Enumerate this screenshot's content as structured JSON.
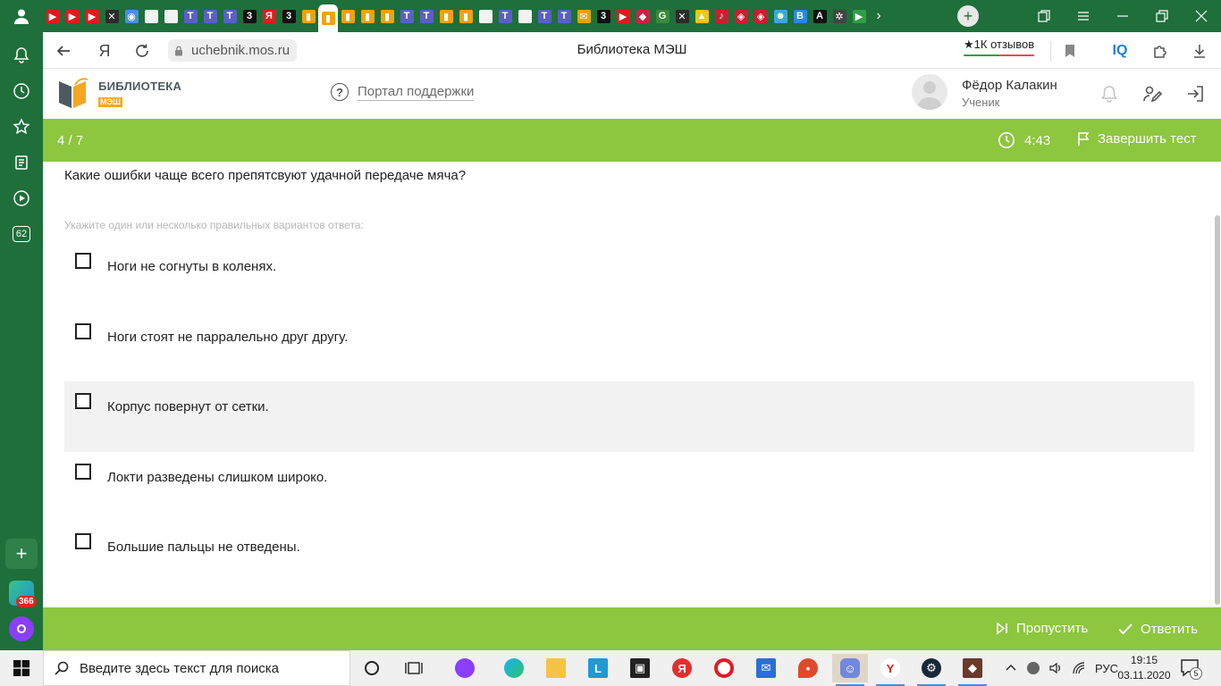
{
  "browser": {
    "url": "uchebnik.mos.ru",
    "page_title": "Библиотека МЭШ",
    "reviews_label": "★1К отзывов",
    "iq_label": "IQ",
    "tab_favicons": [
      {
        "color": "#e01b1b",
        "glyph": "▶"
      },
      {
        "color": "#e01b1b",
        "glyph": "▶"
      },
      {
        "color": "#e01b1b",
        "glyph": "▶"
      },
      {
        "color": "#2b2b2b",
        "glyph": "✕"
      },
      {
        "color": "#4a90d9",
        "glyph": "◉"
      },
      {
        "color": "#f2f2f2",
        "glyph": ""
      },
      {
        "color": "#f2f2f2",
        "glyph": ""
      },
      {
        "color": "#5b5fc7",
        "glyph": "T"
      },
      {
        "color": "#5b5fc7",
        "glyph": "T"
      },
      {
        "color": "#5b5fc7",
        "glyph": "T"
      },
      {
        "color": "#111111",
        "glyph": "3"
      },
      {
        "color": "#e01b1b",
        "glyph": "Я"
      },
      {
        "color": "#111111",
        "glyph": "3"
      },
      {
        "color": "#f0a30a",
        "glyph": "▮"
      },
      {
        "color": "#f0a30a",
        "glyph": "▮",
        "active": true
      },
      {
        "color": "#f0a30a",
        "glyph": "▮"
      },
      {
        "color": "#f0a30a",
        "glyph": "▮"
      },
      {
        "color": "#f0a30a",
        "glyph": "▮"
      },
      {
        "color": "#5b5fc7",
        "glyph": "T"
      },
      {
        "color": "#5b5fc7",
        "glyph": "T"
      },
      {
        "color": "#f0a30a",
        "glyph": "▮"
      },
      {
        "color": "#f0a30a",
        "glyph": "▮"
      },
      {
        "color": "#f2f2f2",
        "glyph": ""
      },
      {
        "color": "#5b5fc7",
        "glyph": "T"
      },
      {
        "color": "#f2f2f2",
        "glyph": ""
      },
      {
        "color": "#5b5fc7",
        "glyph": "T"
      },
      {
        "color": "#5b5fc7",
        "glyph": "T"
      },
      {
        "color": "#e8a20b",
        "glyph": "✉"
      },
      {
        "color": "#111111",
        "glyph": "3"
      },
      {
        "color": "#e01b1b",
        "glyph": "▶"
      },
      {
        "color": "#cc2244",
        "glyph": "◆"
      },
      {
        "color": "#3a8a3a",
        "glyph": "G"
      },
      {
        "color": "#2b2b2b",
        "glyph": "✕"
      },
      {
        "color": "#f5c518",
        "glyph": "▲"
      },
      {
        "color": "#c8202f",
        "glyph": "♪"
      },
      {
        "color": "#c8202f",
        "glyph": "◈"
      },
      {
        "color": "#c8202f",
        "glyph": "◈"
      },
      {
        "color": "#3aa8e0",
        "glyph": "☻"
      },
      {
        "color": "#2787f5",
        "glyph": "B"
      },
      {
        "color": "#111111",
        "glyph": "A"
      },
      {
        "color": "#444444",
        "glyph": "✲"
      },
      {
        "color": "#2ea043",
        "glyph": "▶"
      }
    ],
    "sidebar_badge": "62",
    "sidebar_app_count": "366"
  },
  "site": {
    "logo_line1": "БИБЛИОТЕКА",
    "logo_line2": "МЭШ",
    "support_label": "Портал поддержки",
    "user_name": "Фёдор Калакин",
    "user_role": "Ученик"
  },
  "test": {
    "progress": "4 / 7",
    "timer": "4:43",
    "finish_label": "Завершить тест",
    "question": "Какие ошибки чаще всего препятсвуют удачной передаче мяча?",
    "hint": "Укажите один или несколько правильных вариантов ответа:",
    "options": [
      {
        "label": "Ноги не согнуты в коленях.",
        "checked": false
      },
      {
        "label": "Ноги стоят не парралельно друг другу.",
        "checked": false
      },
      {
        "label": "Корпус повернут от сетки.",
        "checked": false,
        "hovered": true
      },
      {
        "label": "Локти разведены слишком широко.",
        "checked": false
      },
      {
        "label": "Большие пальцы не отведены.",
        "checked": false
      }
    ],
    "skip_label": "Пропустить",
    "answer_label": "Ответить"
  },
  "colors": {
    "accent_green": "#8dc63f",
    "browser_green": "#1e6f3a",
    "logo_orange": "#f5a623"
  },
  "taskbar": {
    "search_placeholder": "Введите здесь текст для поиска",
    "language": "РУС",
    "time": "19:15",
    "date": "03.11.2020",
    "notification_count": "5"
  }
}
